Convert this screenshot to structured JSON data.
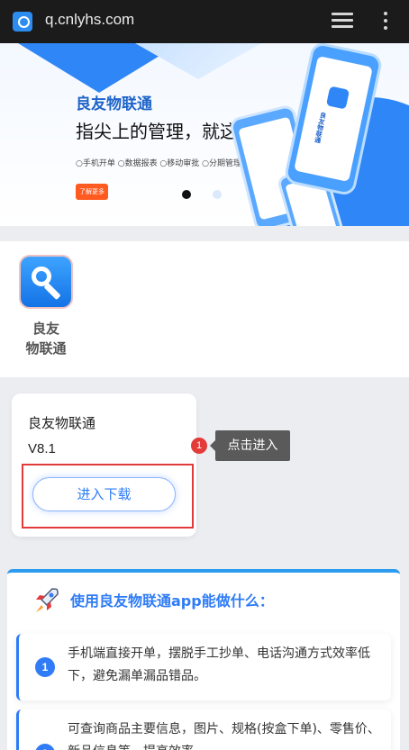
{
  "browser": {
    "url": "q.cnlyhs.com",
    "icons": [
      "site-icon",
      "tabs-icon",
      "menu-icon"
    ]
  },
  "banner": {
    "brand": "良友物联通",
    "slogan": "指尖上的管理，就这么简单!",
    "features": "○手机开单 ○数据报表 ○移动审批 ○分期管理",
    "button": "了解更多",
    "phone_label": "良友物联通",
    "slides_total": 2,
    "active_slide": 1
  },
  "app": {
    "name_line1": "良友",
    "name_line2": "物联通"
  },
  "download": {
    "name": "良友物联通",
    "version": "V8.1",
    "button_label": "进入下载"
  },
  "hint": {
    "badge": "1",
    "text": "点击进入"
  },
  "features": {
    "title": "使用良友物联通app能做什么：",
    "items": [
      {
        "num": "1",
        "text": "手机端直接开单，摆脱手工抄单、电话沟通方式效率低下，避免漏单漏品错品。"
      },
      {
        "num": "2",
        "text": "可查询商品主要信息，图片、规格(按盒下单)、零售价、新品信息等，提高效率。"
      }
    ]
  },
  "colors": {
    "accent": "#2f7cf6",
    "highlight_border": "#e03a3a",
    "badge": "#e33a3a",
    "tooltip_bg": "#5a5a5a"
  }
}
